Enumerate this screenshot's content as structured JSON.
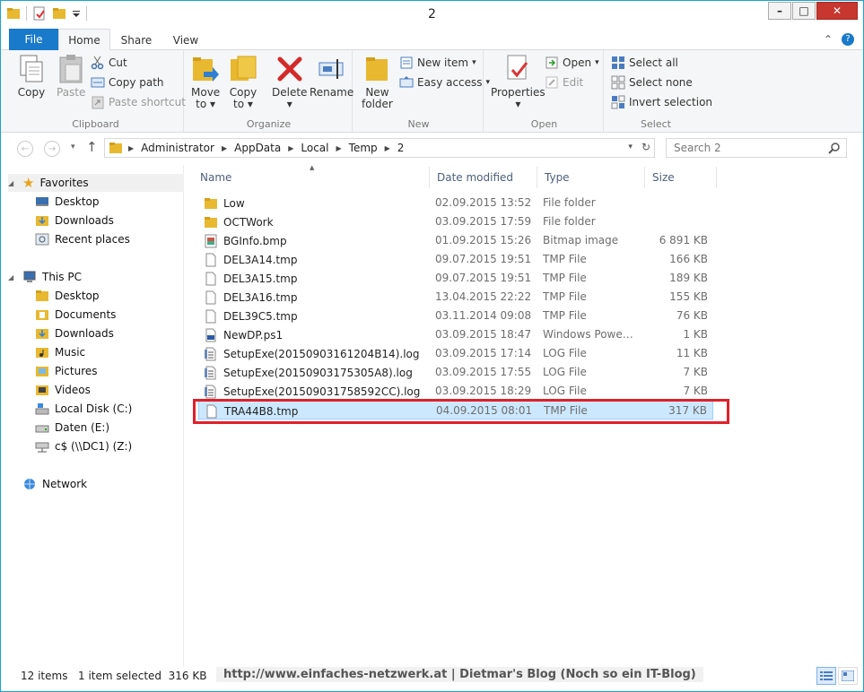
{
  "window": {
    "title": "2"
  },
  "tabs": {
    "file": "File",
    "home": "Home",
    "share": "Share",
    "view": "View"
  },
  "ribbon": {
    "clipboard": {
      "label": "Clipboard",
      "copy": "Copy",
      "paste": "Paste",
      "cut": "Cut",
      "copy_path": "Copy path",
      "paste_shortcut": "Paste shortcut"
    },
    "organize": {
      "label": "Organize",
      "move_to": "Move",
      "move_to2": "to",
      "copy_to": "Copy",
      "copy_to2": "to",
      "delete": "Delete",
      "rename": "Rename"
    },
    "new": {
      "label": "New",
      "new_folder": "New",
      "new_folder2": "folder",
      "new_item": "New item",
      "easy_access": "Easy access"
    },
    "open": {
      "label": "Open",
      "properties": "Properties",
      "open": "Open",
      "edit": "Edit"
    },
    "select": {
      "label": "Select",
      "select_all": "Select all",
      "select_none": "Select none",
      "invert": "Invert selection"
    }
  },
  "address": {
    "crumbs": [
      "Administrator",
      "AppData",
      "Local",
      "Temp",
      "2"
    ],
    "search_placeholder": "Search 2"
  },
  "nav": {
    "favorites": "Favorites",
    "fav_items": [
      "Desktop",
      "Downloads",
      "Recent places"
    ],
    "thispc": "This PC",
    "pc_items": [
      "Desktop",
      "Documents",
      "Downloads",
      "Music",
      "Pictures",
      "Videos",
      "Local Disk (C:)",
      "Daten (E:)",
      "c$ (\\\\DC1) (Z:)"
    ],
    "network": "Network"
  },
  "columns": {
    "name": "Name",
    "date": "Date modified",
    "type": "Type",
    "size": "Size"
  },
  "files": [
    {
      "name": "Low",
      "date": "02.09.2015 13:52",
      "type": "File folder",
      "size": "",
      "icon": "folder-icon"
    },
    {
      "name": "OCTWork",
      "date": "03.09.2015 17:59",
      "type": "File folder",
      "size": "",
      "icon": "folder-icon"
    },
    {
      "name": "BGInfo.bmp",
      "date": "01.09.2015 15:26",
      "type": "Bitmap image",
      "size": "6 891 KB",
      "icon": "image-icon"
    },
    {
      "name": "DEL3A14.tmp",
      "date": "09.07.2015 19:51",
      "type": "TMP File",
      "size": "166 KB",
      "icon": "file-icon"
    },
    {
      "name": "DEL3A15.tmp",
      "date": "09.07.2015 19:51",
      "type": "TMP File",
      "size": "189 KB",
      "icon": "file-icon"
    },
    {
      "name": "DEL3A16.tmp",
      "date": "13.04.2015 22:22",
      "type": "TMP File",
      "size": "155 KB",
      "icon": "file-icon"
    },
    {
      "name": "DEL39C5.tmp",
      "date": "03.11.2014 09:08",
      "type": "TMP File",
      "size": "76 KB",
      "icon": "file-icon"
    },
    {
      "name": "NewDP.ps1",
      "date": "03.09.2015 18:47",
      "type": "Windows PowerS...",
      "size": "1 KB",
      "icon": "script-icon"
    },
    {
      "name": "SetupExe(20150903161204B14).log",
      "date": "03.09.2015 17:14",
      "type": "LOG File",
      "size": "11 KB",
      "icon": "log-icon"
    },
    {
      "name": "SetupExe(20150903175305A8).log",
      "date": "03.09.2015 17:55",
      "type": "LOG File",
      "size": "7 KB",
      "icon": "log-icon"
    },
    {
      "name": "SetupExe(201509031758592CC).log",
      "date": "03.09.2015 18:29",
      "type": "LOG File",
      "size": "7 KB",
      "icon": "log-icon"
    },
    {
      "name": "TRA44B8.tmp",
      "date": "04.09.2015 08:01",
      "type": "TMP File",
      "size": "317 KB",
      "icon": "file-icon",
      "selected": true
    }
  ],
  "status": {
    "items": "12 items",
    "selected": "1 item selected  316 KB"
  },
  "watermark": "http://www.einfaches-netzwerk.at | Dietmar's Blog (Noch so ein IT-Blog)",
  "colors": {
    "accent": "#1979ca",
    "highlight": "#e0202a",
    "selection": "#cce8ff"
  }
}
